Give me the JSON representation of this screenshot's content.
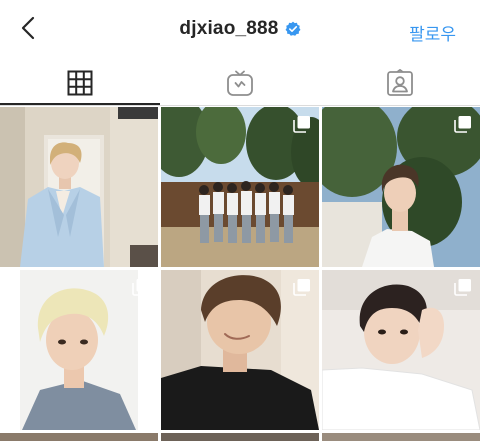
{
  "header": {
    "username": "djxiao_888",
    "follow_label": "팔로우"
  },
  "tabs": [
    {
      "name": "posts-grid"
    },
    {
      "name": "igtv"
    },
    {
      "name": "tagged"
    }
  ],
  "posts": [
    {
      "multiple": false
    },
    {
      "multiple": true
    },
    {
      "multiple": true
    },
    {
      "multiple": true
    },
    {
      "multiple": true
    },
    {
      "multiple": true
    }
  ]
}
